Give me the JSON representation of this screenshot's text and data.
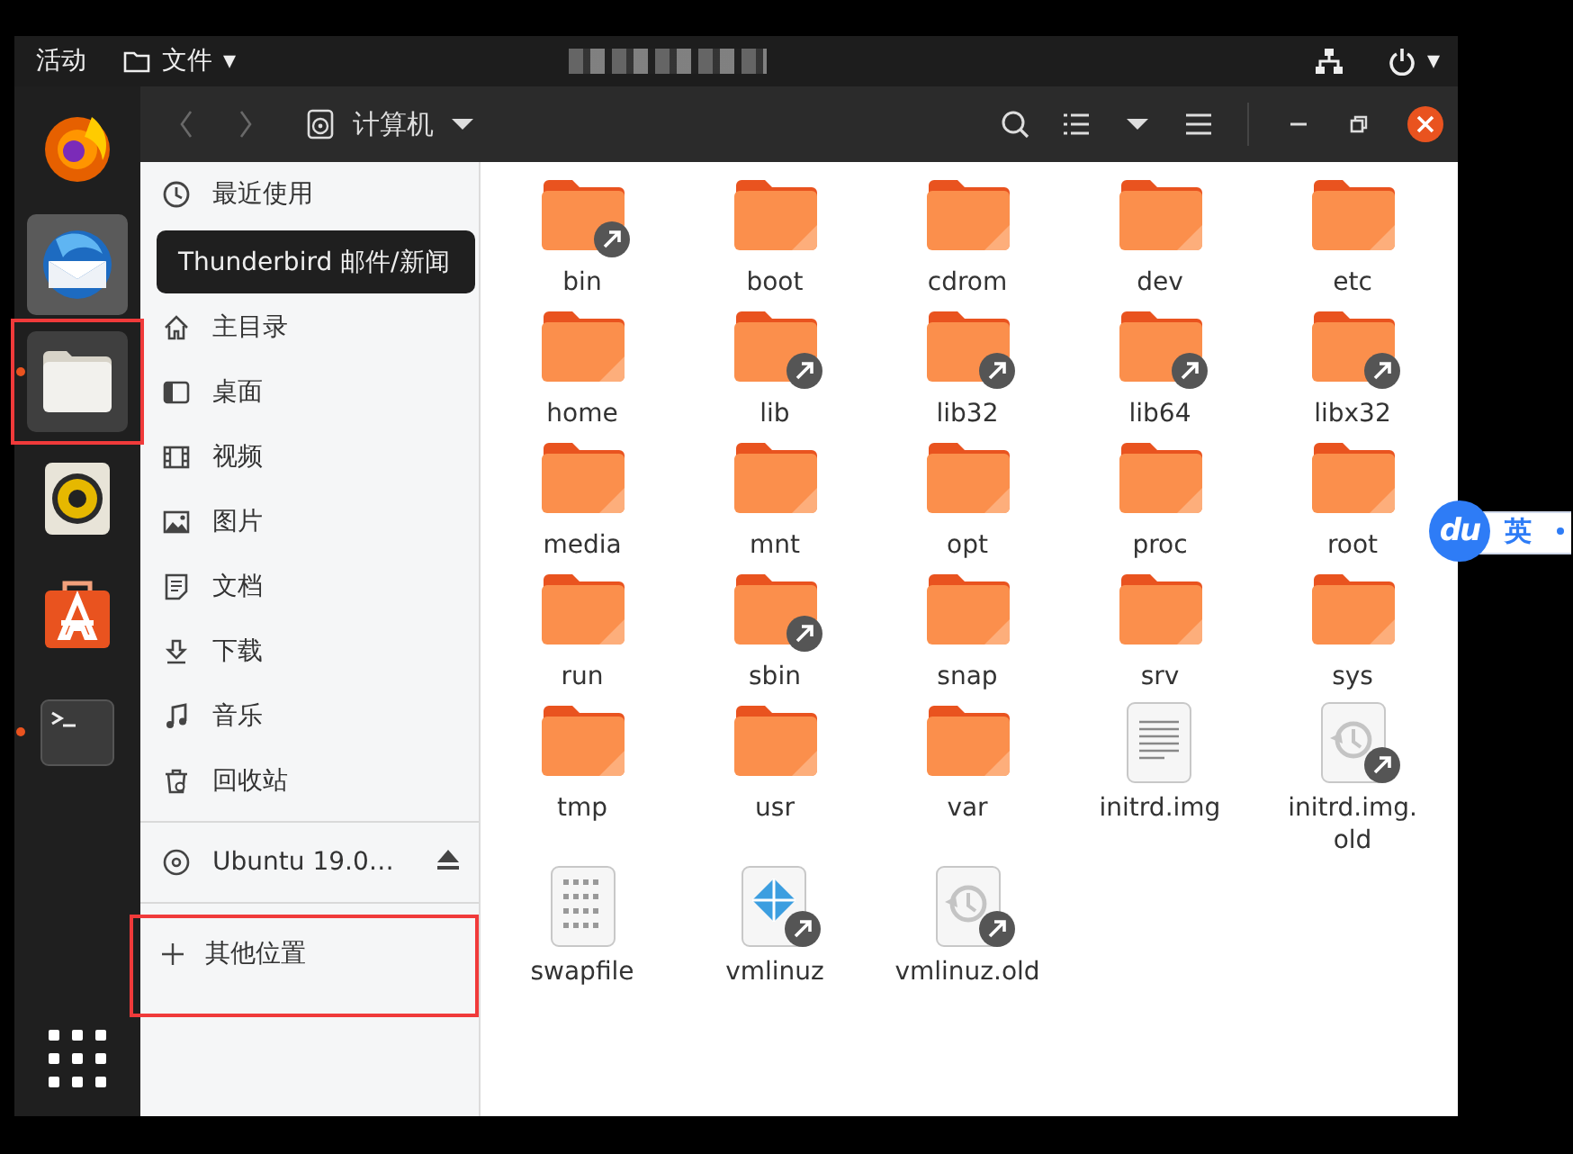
{
  "top_bar": {
    "activities": "活动",
    "app_menu": "文件",
    "app_menu_caret": "▾",
    "status_caret": "▾"
  },
  "dock": {
    "items": [
      {
        "kind": "firefox",
        "hovered": false,
        "focused": false,
        "running": false,
        "outlined": false
      },
      {
        "kind": "thunderbird",
        "hovered": true,
        "focused": false,
        "running": false,
        "outlined": false
      },
      {
        "kind": "files",
        "hovered": false,
        "focused": true,
        "running": true,
        "outlined": true
      },
      {
        "kind": "rhythmbox",
        "hovered": false,
        "focused": false,
        "running": false,
        "outlined": false
      },
      {
        "kind": "software",
        "hovered": false,
        "focused": false,
        "running": false,
        "outlined": false
      },
      {
        "kind": "terminal",
        "hovered": false,
        "focused": false,
        "running": true,
        "outlined": false
      }
    ]
  },
  "header": {
    "back_disabled": true,
    "forward_disabled": true,
    "path": "计算机"
  },
  "tooltip": "Thunderbird 邮件/新闻",
  "sidebar": {
    "places": [
      {
        "kind": "recent",
        "label": "最近使用"
      },
      {
        "kind": "tooltip-slot"
      },
      {
        "kind": "home",
        "label": "主目录"
      },
      {
        "kind": "desktop",
        "label": "桌面"
      },
      {
        "kind": "videos",
        "label": "视频"
      },
      {
        "kind": "pictures",
        "label": "图片"
      },
      {
        "kind": "documents",
        "label": "文档"
      },
      {
        "kind": "downloads",
        "label": "下载"
      },
      {
        "kind": "music",
        "label": "音乐"
      },
      {
        "kind": "trash",
        "label": "回收站"
      }
    ],
    "devices": [
      {
        "label": "Ubuntu 19.0…",
        "ejectable": true
      }
    ],
    "other": {
      "label": "其他位置",
      "outlined": true
    }
  },
  "files": [
    {
      "name": "bin",
      "kind": "folder",
      "link": true
    },
    {
      "name": "boot",
      "kind": "folder",
      "link": false
    },
    {
      "name": "cdrom",
      "kind": "folder",
      "link": false
    },
    {
      "name": "dev",
      "kind": "folder",
      "link": false
    },
    {
      "name": "etc",
      "kind": "folder",
      "link": false
    },
    {
      "name": "home",
      "kind": "folder",
      "link": false
    },
    {
      "name": "lib",
      "kind": "folder",
      "link": true
    },
    {
      "name": "lib32",
      "kind": "folder",
      "link": true
    },
    {
      "name": "lib64",
      "kind": "folder",
      "link": true
    },
    {
      "name": "libx32",
      "kind": "folder",
      "link": true
    },
    {
      "name": "media",
      "kind": "folder",
      "link": false
    },
    {
      "name": "mnt",
      "kind": "folder",
      "link": false
    },
    {
      "name": "opt",
      "kind": "folder",
      "link": false
    },
    {
      "name": "proc",
      "kind": "folder",
      "link": false
    },
    {
      "name": "root",
      "kind": "folder",
      "link": false
    },
    {
      "name": "run",
      "kind": "folder",
      "link": false
    },
    {
      "name": "sbin",
      "kind": "folder",
      "link": true
    },
    {
      "name": "snap",
      "kind": "folder",
      "link": false
    },
    {
      "name": "srv",
      "kind": "folder",
      "link": false
    },
    {
      "name": "sys",
      "kind": "folder",
      "link": false
    },
    {
      "name": "tmp",
      "kind": "folder",
      "link": false
    },
    {
      "name": "usr",
      "kind": "folder",
      "link": false
    },
    {
      "name": "var",
      "kind": "folder",
      "link": false
    },
    {
      "name": "initrd.img",
      "kind": "text",
      "link": false
    },
    {
      "name": "initrd.img.old",
      "kind": "backup",
      "link": true
    },
    {
      "name": "swapfile",
      "kind": "binary",
      "link": false
    },
    {
      "name": "vmlinuz",
      "kind": "kernel",
      "link": true
    },
    {
      "name": "vmlinuz.old",
      "kind": "backup",
      "link": true
    }
  ],
  "ime": {
    "logo": "du",
    "mode": "英"
  }
}
